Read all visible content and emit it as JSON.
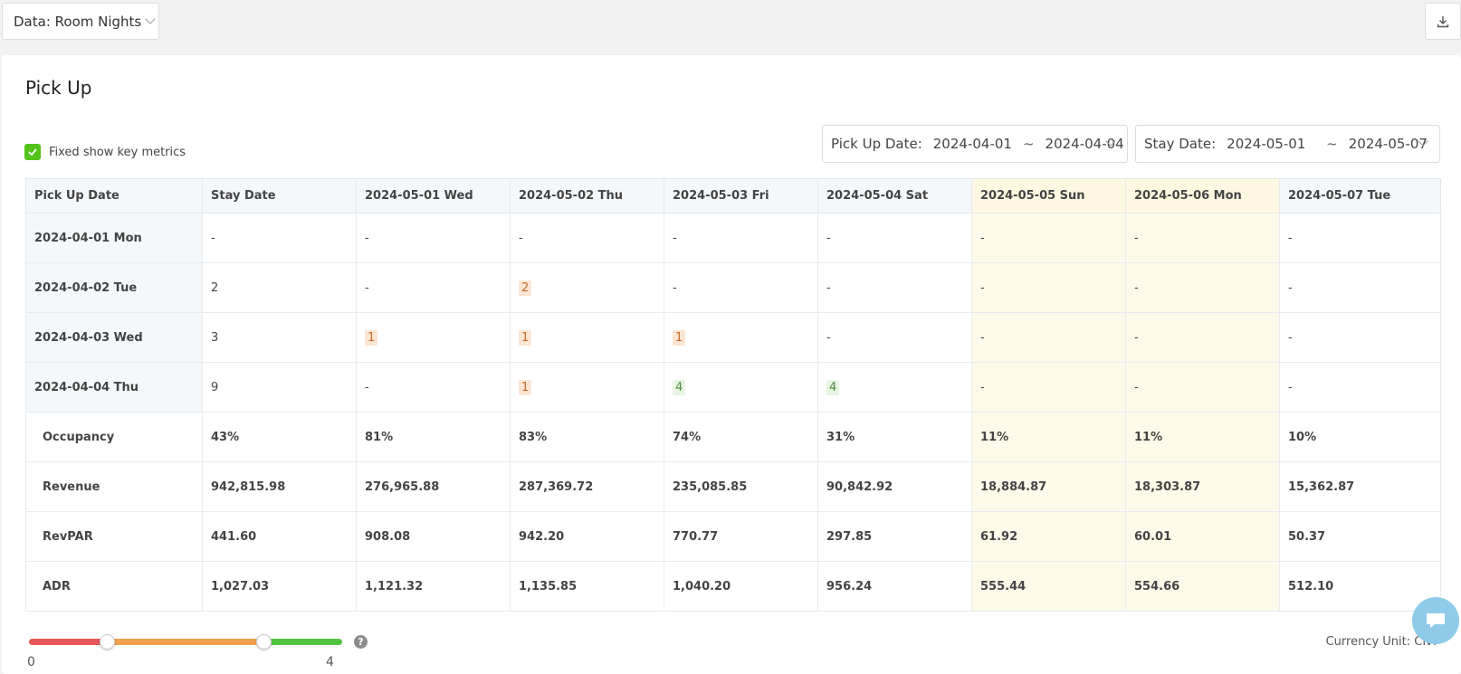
{
  "toolbar": {
    "data_select": "Data: Room Nights",
    "download_icon": "download-icon"
  },
  "card": {
    "title": "Pick Up",
    "fixed_checkbox_label": "Fixed show key metrics",
    "fixed_checked": true,
    "pick_up_range": {
      "label": "Pick Up Date:",
      "start": "2024-04-01",
      "sep": "~",
      "end": "2024-04-04"
    },
    "stay_range": {
      "label": "Stay Date:",
      "start": "2024-05-01",
      "sep": "~",
      "end": "2024-05-07"
    }
  },
  "table": {
    "headers": [
      "Pick Up Date",
      "Stay Date",
      "2024-05-01 Wed",
      "2024-05-02 Thu",
      "2024-05-03 Fri",
      "2024-05-04 Sat",
      "2024-05-05 Sun",
      "2024-05-06 Mon",
      "2024-05-07 Tue"
    ],
    "pickup_rows": [
      {
        "date": "2024-04-01 Mon",
        "total": "-",
        "cells": [
          "-",
          "-",
          "-",
          "-",
          "-",
          "-",
          "-"
        ]
      },
      {
        "date": "2024-04-02 Tue",
        "total": "2",
        "cells": [
          "-",
          "2",
          "-",
          "-",
          "-",
          "-",
          "-"
        ]
      },
      {
        "date": "2024-04-03 Wed",
        "total": "3",
        "cells": [
          "1",
          "1",
          "1",
          "-",
          "-",
          "-",
          "-"
        ]
      },
      {
        "date": "2024-04-04 Thu",
        "total": "9",
        "cells": [
          "-",
          "1",
          "4",
          "4",
          "-",
          "-",
          "-"
        ]
      }
    ],
    "metric_rows": [
      {
        "name": "Occupancy",
        "values": [
          "43%",
          "81%",
          "83%",
          "74%",
          "31%",
          "11%",
          "11%",
          "10%"
        ]
      },
      {
        "name": "Revenue",
        "values": [
          "942,815.98",
          "276,965.88",
          "287,369.72",
          "235,085.85",
          "90,842.92",
          "18,884.87",
          "18,303.87",
          "15,362.87"
        ]
      },
      {
        "name": "RevPAR",
        "values": [
          "441.60",
          "908.08",
          "942.20",
          "770.77",
          "297.85",
          "61.92",
          "60.01",
          "50.37"
        ]
      },
      {
        "name": "ADR",
        "values": [
          "1,027.03",
          "1,121.32",
          "1,135.85",
          "1,040.20",
          "956.24",
          "555.44",
          "554.66",
          "512.10"
        ]
      }
    ]
  },
  "legend_slider": {
    "min": "0",
    "max": "4",
    "low_thumb": 1,
    "high_thumb": 3,
    "colors": {
      "low": "#e85858",
      "mid": "#f1a04d",
      "high": "#52c441"
    },
    "help": "?"
  },
  "footer": {
    "currency": "Currency Unit: CNY"
  },
  "colors": {
    "weekend_bg": "#fefaea",
    "header_bg": "#f5f8fb",
    "accent_green": "#52c41a"
  }
}
